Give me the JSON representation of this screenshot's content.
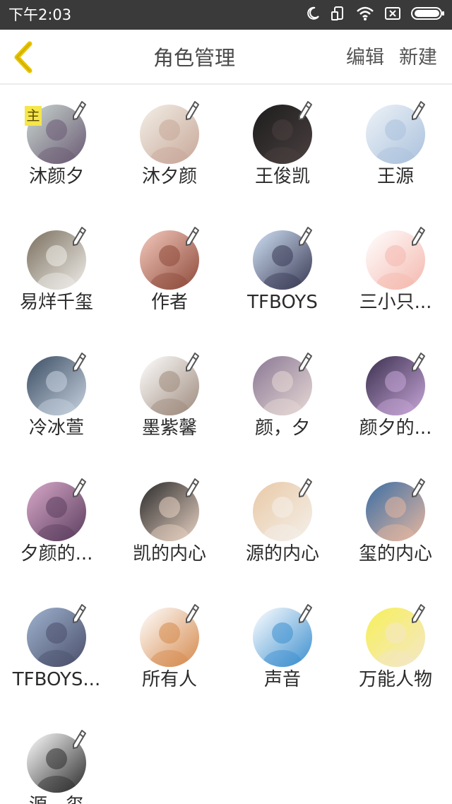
{
  "status_bar": {
    "time": "下午2:03",
    "icons": [
      "moon-icon",
      "screen-rotate-icon",
      "wifi-icon",
      "sim-off-icon",
      "battery-icon"
    ]
  },
  "header": {
    "back_icon": "chevron-left-icon",
    "title": "角色管理",
    "edit_label": "编辑",
    "new_label": "新建"
  },
  "colors": {
    "accent": "#e8c400",
    "badge_bg": "#f5e64a",
    "status_bar_bg": "#3a3a3a",
    "title_text": "#4a4a4a"
  },
  "main_badge": "主",
  "roles": [
    {
      "name": "沐颜夕",
      "avatar": [
        "#c9d6cf",
        "#6a5a74"
      ]
    },
    {
      "name": "沐夕颜",
      "avatar": [
        "#f3efe7",
        "#c7a798"
      ]
    },
    {
      "name": "王俊凯",
      "avatar": [
        "#1c1c1c",
        "#4b4040"
      ]
    },
    {
      "name": "王源",
      "avatar": [
        "#eef3f8",
        "#aac1dc"
      ]
    },
    {
      "name": "易烊千玺",
      "avatar": [
        "#7a6f5e",
        "#f0eeea"
      ]
    },
    {
      "name": "作者",
      "avatar": [
        "#f4c9bd",
        "#8e4b3b"
      ]
    },
    {
      "name": "TFBOYS",
      "avatar": [
        "#cfe0f4",
        "#3a3a55"
      ]
    },
    {
      "name": "三小只...",
      "avatar": [
        "#ffffff",
        "#f4b8ae"
      ]
    },
    {
      "name": "冷冰萱",
      "avatar": [
        "#3b4d63",
        "#c8d3e0"
      ]
    },
    {
      "name": "墨紫馨",
      "avatar": [
        "#ffffff",
        "#9e8a7c"
      ]
    },
    {
      "name": "颜，夕",
      "avatar": [
        "#8a7894",
        "#e7d9d6"
      ]
    },
    {
      "name": "颜夕的...",
      "avatar": [
        "#3a2f4e",
        "#c7a6d8"
      ]
    },
    {
      "name": "夕颜的...",
      "avatar": [
        "#d8a8c8",
        "#5b3e5f"
      ]
    },
    {
      "name": "凯的内心",
      "avatar": [
        "#2a2a2a",
        "#e8d2c3"
      ]
    },
    {
      "name": "源的内心",
      "avatar": [
        "#e9c9a6",
        "#f4f0ea"
      ]
    },
    {
      "name": "玺的内心",
      "avatar": [
        "#3c6ea4",
        "#e6b7a0"
      ]
    },
    {
      "name": "TFBOYS...",
      "avatar": [
        "#9fb3cf",
        "#4a4f6b"
      ]
    },
    {
      "name": "所有人",
      "avatar": [
        "#ffffff",
        "#d58a4d"
      ]
    },
    {
      "name": "声音",
      "avatar": [
        "#ffffff",
        "#3c8fcf"
      ]
    },
    {
      "name": "万能人物",
      "avatar": [
        "#f7f058",
        "#f4e7c8"
      ]
    },
    {
      "name": "源，玺",
      "avatar": [
        "#ffffff",
        "#2b2b2b"
      ]
    }
  ]
}
